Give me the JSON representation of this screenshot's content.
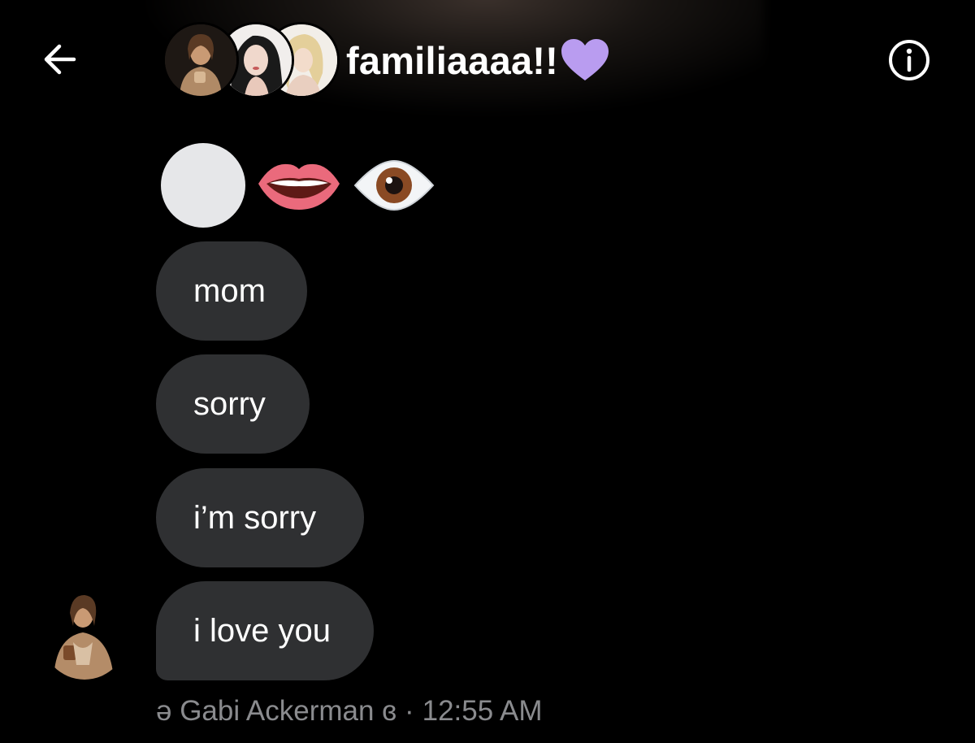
{
  "header": {
    "title": "familiaaaa!!",
    "heart_color": "#b99cf0",
    "back_icon": "arrow-left-icon",
    "info_icon": "info-circle-icon",
    "members": [
      "member-avatar-1",
      "member-avatar-2",
      "member-avatar-3"
    ]
  },
  "emoji_message": {
    "emojis": [
      "blank-circle",
      "lips-emoji",
      "eye-emoji"
    ]
  },
  "messages": [
    {
      "text": "mom"
    },
    {
      "text": "sorry"
    },
    {
      "text": "i’m sorry"
    },
    {
      "text": "i love you"
    }
  ],
  "footer": {
    "sender": "ə Gabi Ackerman ɞ",
    "separator": "·",
    "time": "12:55 AM"
  },
  "colors": {
    "background": "#000000",
    "bubble": "#2f3032",
    "meta_text": "#8a8b8e"
  }
}
